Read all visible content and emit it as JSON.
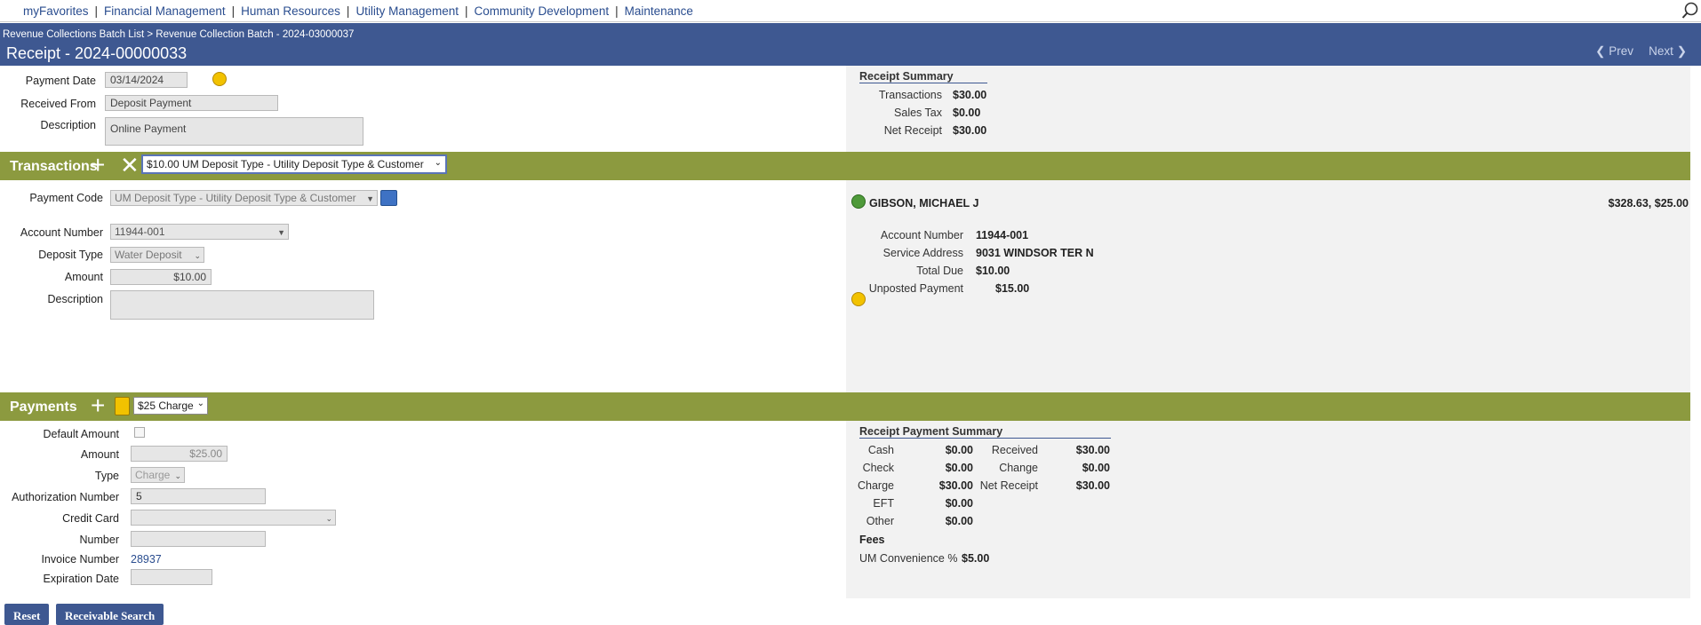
{
  "nav": {
    "items": [
      "myFavorites",
      "Financial Management",
      "Human Resources",
      "Utility Management",
      "Community Development",
      "Maintenance"
    ],
    "sep": "|",
    "search_icon": "search-icon"
  },
  "header": {
    "breadcrumb": "Revenue Collections Batch List > Revenue Collection Batch - 2024-03000037",
    "title": "Receipt - 2024-00000033",
    "prev": "Prev",
    "next": "Next"
  },
  "receipt": {
    "payment_date_label": "Payment Date",
    "payment_date": "03/14/2024",
    "received_from_label": "Received From",
    "received_from": "Deposit Payment",
    "description_label": "Description",
    "description": "Online Payment"
  },
  "receipt_summary": {
    "heading": "Receipt Summary",
    "rows": [
      {
        "label": "Transactions",
        "value": "$30.00"
      },
      {
        "label": "Sales Tax",
        "value": "$0.00"
      },
      {
        "label": "Net Receipt",
        "value": "$30.00"
      }
    ]
  },
  "transactions": {
    "title": "Transactions",
    "selected": "$10.00 UM Deposit Type - Utility Deposit Type & Customer",
    "payment_code_label": "Payment Code",
    "payment_code": "UM Deposit Type - Utility Deposit Type & Customer",
    "account_number_label": "Account Number",
    "account_number": "11944-001",
    "deposit_type_label": "Deposit Type",
    "deposit_type": "Water Deposit",
    "amount_label": "Amount",
    "amount": "$10.00",
    "description_label": "Description",
    "description": ""
  },
  "customer": {
    "name": "GIBSON, MICHAEL J",
    "balances": "$328.63, $25.00",
    "rows": [
      {
        "label": "Account Number",
        "value": "11944-001"
      },
      {
        "label": "Service Address",
        "value": "9031 WINDSOR TER N"
      },
      {
        "label": "Total Due",
        "value": "$10.00"
      },
      {
        "label": "Unposted Payment",
        "value": "$15.00"
      }
    ]
  },
  "payments": {
    "title": "Payments",
    "selected": "$25 Charge",
    "default_amount_label": "Default Amount",
    "amount_label": "Amount",
    "amount": "$25.00",
    "type_label": "Type",
    "type": "Charge",
    "auth_label": "Authorization Number",
    "auth": "5",
    "credit_card_label": "Credit Card",
    "credit_card": "",
    "number_label": "Number",
    "number": "",
    "invoice_label": "Invoice Number",
    "invoice": "28937",
    "expiration_label": "Expiration Date",
    "expiration": ""
  },
  "payment_summary": {
    "heading": "Receipt Payment Summary",
    "left": [
      {
        "label": "Cash",
        "value": "$0.00"
      },
      {
        "label": "Check",
        "value": "$0.00"
      },
      {
        "label": "Charge",
        "value": "$30.00"
      },
      {
        "label": "EFT",
        "value": "$0.00"
      },
      {
        "label": "Other",
        "value": "$0.00"
      }
    ],
    "right": [
      {
        "label": "Received",
        "value": "$30.00"
      },
      {
        "label": "Change",
        "value": "$0.00"
      },
      {
        "label": "Net Receipt",
        "value": "$30.00"
      }
    ],
    "fees_heading": "Fees",
    "fee_label": "UM Convenience %",
    "fee_value": "$5.00"
  },
  "buttons": {
    "reset": "Reset",
    "receivable_search": "Receivable Search"
  },
  "colors": {
    "header_blue": "#3e5891",
    "section_green": "#8c9a3f",
    "panel_gray": "#f2f2f2"
  }
}
